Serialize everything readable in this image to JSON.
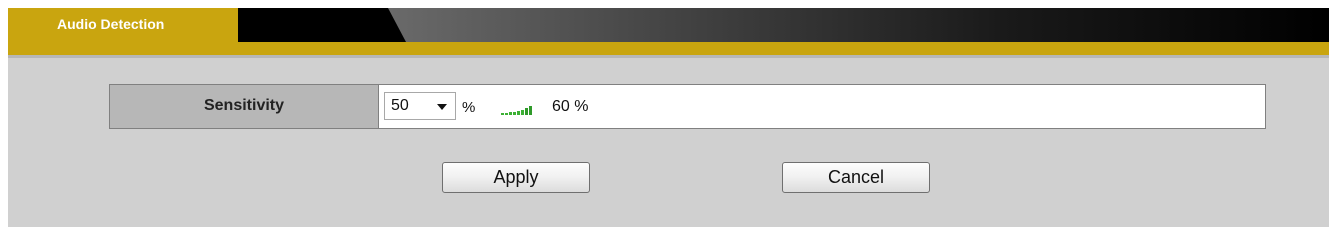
{
  "tab": {
    "label": "Audio Detection"
  },
  "sensitivity": {
    "label": "Sensitivity",
    "selected_value": "50",
    "unit": "%",
    "current_level_text": "60 %",
    "meter_icon": "signal-level-icon"
  },
  "buttons": {
    "apply_label": "Apply",
    "cancel_label": "Cancel"
  },
  "colors": {
    "accent_gold": "#c9a50f",
    "header_black": "#000000",
    "panel_gray": "#d0d0d0",
    "label_gray": "#b7b7b7",
    "meter_green": "#3cb034"
  }
}
